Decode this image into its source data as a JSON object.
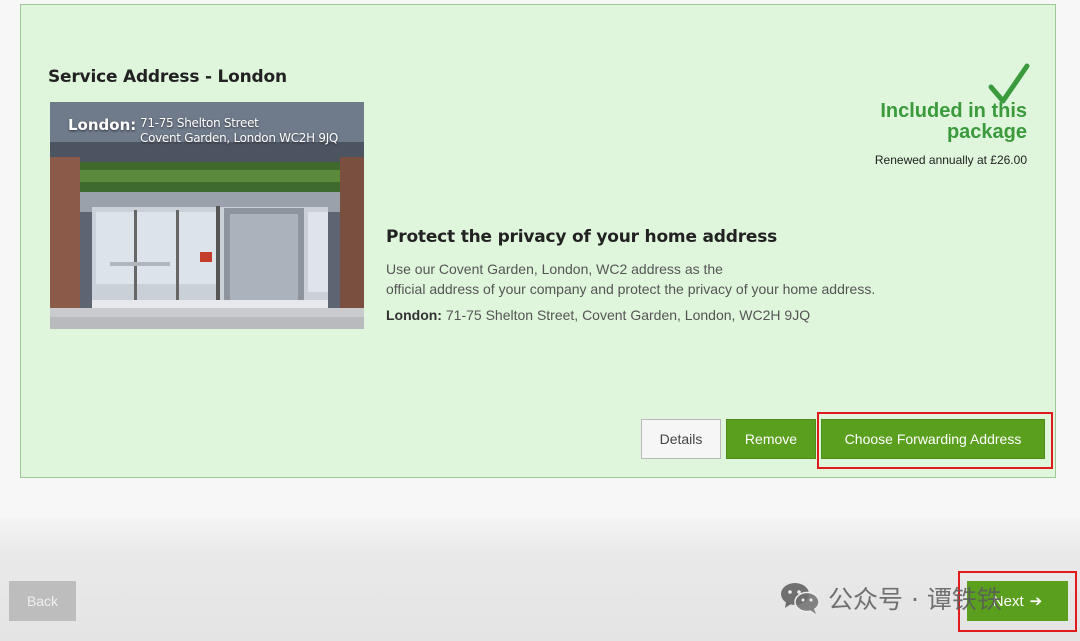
{
  "service": {
    "title": "Service Address - London",
    "photo_caption": {
      "city": "London:",
      "line1": "71-75 Shelton Street",
      "line2": "Covent Garden, London WC2H 9JQ"
    },
    "status": {
      "included_line1": "Included in this",
      "included_line2": "package",
      "renewal": "Renewed annually at £26.00",
      "icon": "check-icon",
      "color": "#3a9a3c"
    },
    "feature": {
      "heading": "Protect the privacy of your home address",
      "desc_line1": "Use our Covent Garden, London, WC2 address as the",
      "desc_line2": "official address of your company and protect the privacy of your home address.",
      "address_label": "London:",
      "address_value": "71-75 Shelton Street, Covent Garden, London, WC2H 9JQ"
    },
    "buttons": {
      "details": "Details",
      "remove": "Remove",
      "forward": "Choose Forwarding Address"
    }
  },
  "nav": {
    "back": "Back",
    "next": "Next",
    "next_icon": "arrow-right-icon"
  },
  "watermark": {
    "text": "公众号 · 谭铁铁",
    "icon": "wechat-icon"
  },
  "colors": {
    "accent_green": "#5a9f1e",
    "card_bg": "#dff6dc",
    "highlight": "#e01b1b"
  }
}
